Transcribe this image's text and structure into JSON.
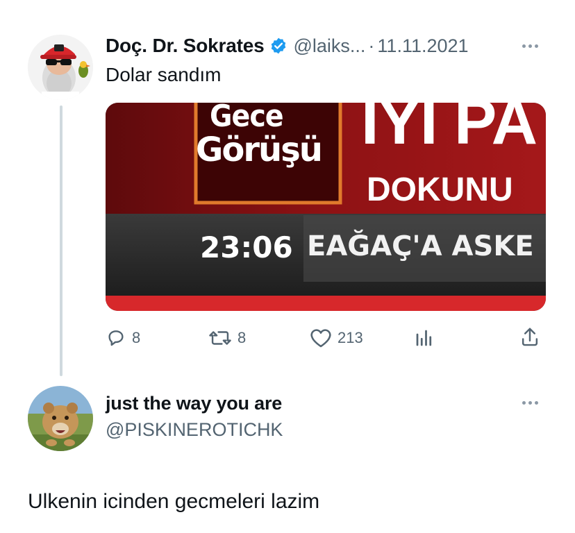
{
  "tweet": {
    "author_name": "Doç. Dr. Sokrates",
    "handle": "@laiks...",
    "separator": "·",
    "date": "11.11.2021",
    "text": "Dolar sandım",
    "media": {
      "show_title_1": "Gece",
      "show_title_2": "Görüşü",
      "headline": "İYİ PA",
      "subheadline": "DOKUNU",
      "clock": "23:06",
      "ticker": "EAĞAÇ'A ASKE"
    },
    "stats": {
      "replies": "8",
      "retweets": "8",
      "likes": "213"
    }
  },
  "reply": {
    "author_name": "just the way you are",
    "handle": "@PISKINEROTICHK",
    "text": "Ulkenin icinden gecmeleri lazim"
  },
  "colors": {
    "accent": "#1d9bf0",
    "news_red": "#b7191c",
    "ticker_dark": "#2a2a2a"
  }
}
